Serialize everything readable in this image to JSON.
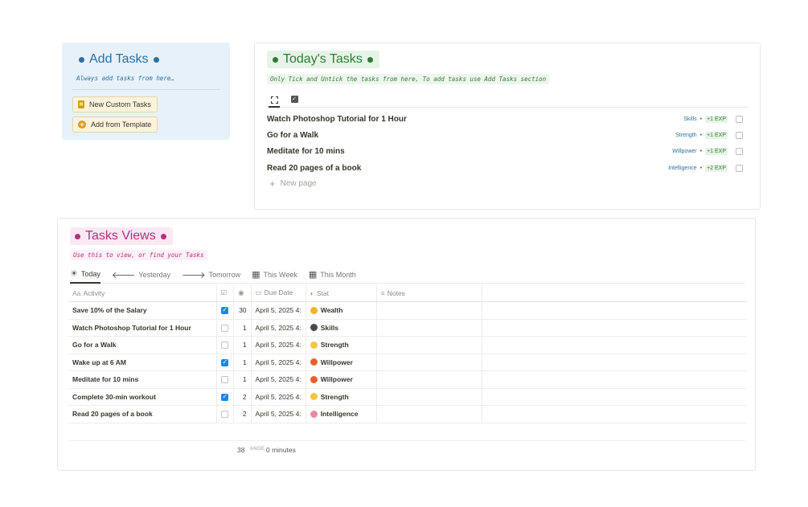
{
  "add_tasks": {
    "title": "Add Tasks",
    "subtitle": "Always add tasks from here…",
    "buttons": [
      {
        "label": "New Custom Tasks",
        "icon": "document-icon"
      },
      {
        "label": "Add from Template",
        "icon": "plus-circle-icon"
      }
    ]
  },
  "today_tasks": {
    "title": "Today's Tasks",
    "subtitle": "Only Tick and Untick the tasks from here, To add tasks use Add Tasks section",
    "tabs": [
      {
        "icon": "unchecked-square-icon",
        "active": true
      },
      {
        "icon": "checked-square-icon",
        "active": false
      }
    ],
    "items": [
      {
        "name": "Watch Photoshop Tutorial for 1 Hour",
        "stat": "Skills",
        "exp": "+1 EXP"
      },
      {
        "name": "Go for a Walk",
        "stat": "Strength",
        "exp": "+1 EXP"
      },
      {
        "name": "Meditate for 10 mins",
        "stat": "Willpower",
        "exp": "+1 EXP"
      },
      {
        "name": "Read 20 pages of a book",
        "stat": "Intelligence",
        "exp": "+2 EXP"
      }
    ],
    "new_page": "New page"
  },
  "tasks_views": {
    "title": "Tasks Views",
    "subtitle": "Use this to view, or find your Tasks",
    "tabs": [
      {
        "label": "Today",
        "icon": "sun-icon",
        "active": true
      },
      {
        "label": "Yesterday",
        "icon": "arrow-left-icon",
        "active": false
      },
      {
        "label": "Tomorrow",
        "icon": "arrow-right-icon",
        "active": false
      },
      {
        "label": "This Week",
        "icon": "calendar-icon",
        "active": false
      },
      {
        "label": "This Month",
        "icon": "calendar-icon",
        "active": false
      }
    ],
    "columns": {
      "activity": "Activity",
      "due_date": "Due Date",
      "stat": "Stat",
      "notes": "Notes"
    },
    "rows": [
      {
        "activity": "Save 10% of the Salary",
        "done": true,
        "num": "30",
        "due": "April 5, 2025 4:",
        "stat": "Wealth",
        "stat_color": "#f0b429"
      },
      {
        "activity": "Watch Photoshop Tutorial for 1 Hour",
        "done": false,
        "num": "1",
        "due": "April 5, 2025 4:",
        "stat": "Skills",
        "stat_color": "#4a4a4a"
      },
      {
        "activity": "Go for a Walk",
        "done": false,
        "num": "1",
        "due": "April 5, 2025 4:",
        "stat": "Strength",
        "stat_color": "#f5c542"
      },
      {
        "activity": "Wake up at 6 AM",
        "done": true,
        "num": "1",
        "due": "April 5, 2025 4:",
        "stat": "Willpower",
        "stat_color": "#e8612c"
      },
      {
        "activity": "Meditate for 10 mins",
        "done": false,
        "num": "1",
        "due": "April 5, 2025 4:",
        "stat": "Willpower",
        "stat_color": "#e8612c"
      },
      {
        "activity": "Complete 30-min workout",
        "done": true,
        "num": "2",
        "due": "April 5, 2025 4:",
        "stat": "Strength",
        "stat_color": "#f5c542"
      },
      {
        "activity": "Read 20 pages of a book",
        "done": false,
        "num": "2",
        "due": "April 5, 2025 4:",
        "stat": "Intelligence",
        "stat_color": "#e88aa6"
      }
    ],
    "footer": {
      "sum": "38",
      "range_label": "ANGE",
      "range_value": "0 minutes"
    }
  }
}
